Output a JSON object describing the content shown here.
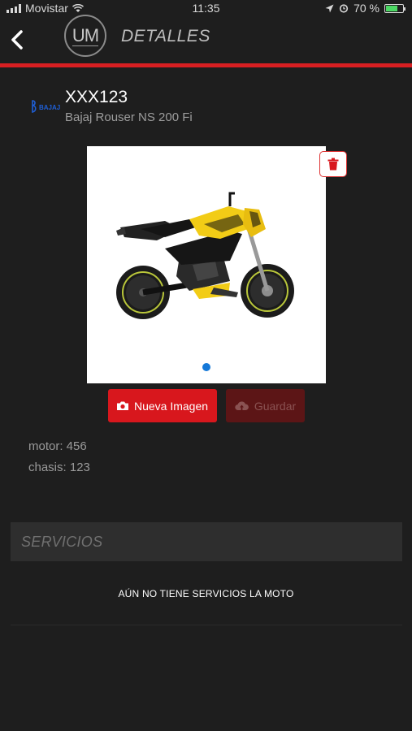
{
  "status_bar": {
    "carrier": "Movistar",
    "time": "11:35",
    "battery_percent": "70 %",
    "battery_level": 0.7
  },
  "header": {
    "back_icon": "chevron-left-icon",
    "logo_text": "UM",
    "title": "DETALLES"
  },
  "vehicle": {
    "brand_logo_icon": "bajaj-logo",
    "plate": "XXX123",
    "model": "Bajaj Rouser NS 200 Fi",
    "motor": "motor: 456",
    "chasis": "chasis: 123"
  },
  "gallery": {
    "delete_icon": "trash-icon",
    "images_count": 1,
    "active_index": 0
  },
  "actions": {
    "new_image_label": "Nueva Imagen",
    "new_image_icon": "camera-icon",
    "save_label": "Guardar",
    "save_icon": "cloud-upload-icon"
  },
  "services": {
    "title": "SERVICIOS",
    "empty_message": "AÚN NO TIENE SERVICIOS LA MOTO"
  },
  "colors": {
    "background": "#1e1e1e",
    "accent_red": "#d8171d",
    "page_indicator": "#1478d8",
    "battery": "#4cd964"
  }
}
